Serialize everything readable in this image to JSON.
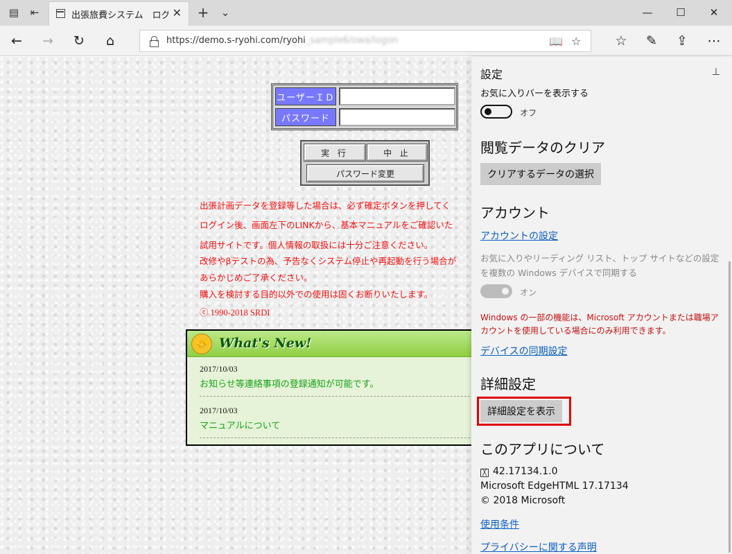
{
  "browser": {
    "tab_title": "出張旅費システム　ログオ",
    "url_visible": "https://demo.s-ryohi.com/ryohi",
    "url_blurred": "_sample6/owa/logon"
  },
  "login": {
    "user_label": "ユーザーＩＤ",
    "password_label": "パスワード",
    "execute_label": "実 行",
    "cancel_label": "中 止",
    "change_password_label": "パスワード変更"
  },
  "notices": [
    "出張計画データを登録等した場合は、必ず確定ボタンを押してく",
    "ログイン後、画面左下のLINKから、基本マニュアルをご確認いた",
    "試用サイトです。個人情報の取扱には十分ご注意ください。",
    "改修やβテストの為、予告なくシステム停止や再起動を行う場合が",
    "あらかじめご了承ください。",
    "購入を検討する目的以外での使用は固くお断りいたします。",
    "ⓒ 1990-2018 SRDI"
  ],
  "whats_new": {
    "title": "What's New!",
    "items": [
      {
        "date": "2017/10/03",
        "text": "お知らせ等連絡事項の登録通知が可能です。"
      },
      {
        "date": "2017/10/03",
        "text": "マニュアルについて"
      }
    ]
  },
  "settings": {
    "title": "設定",
    "favorites_bar_label": "お気に入りバーを表示する",
    "favorites_toggle_state": "オフ",
    "clear_data_heading": "閲覧データのクリア",
    "clear_data_button": "クリアするデータの選択",
    "account_heading": "アカウント",
    "account_settings_link": "アカウントの設定",
    "sync_description": "お気に入りやリーディング リスト、トップ サイトなどの設定を複数の Windows デバイスで同期する",
    "sync_toggle_state": "オン",
    "warning_text": "Windows の一部の機能は、Microsoft アカウントまたは職場アカウントを使用している場合にのみ利用できます。",
    "device_sync_link": "デバイスの同期設定",
    "advanced_heading": "詳細設定",
    "advanced_button": "詳細設定を表示",
    "about_heading": "このアプリについて",
    "app_version": "42.17134.1.0",
    "engine_version": "Microsoft EdgeHTML 17.17134",
    "copyright": "© 2018 Microsoft",
    "terms_link": "使用条件",
    "privacy_link": "プライバシーに関する声明"
  },
  "colors": {
    "login_label_bg": "#7878ff",
    "notice_red": "#f01010",
    "news_green": "#17a217",
    "settings_link": "#0a5ec0",
    "highlight_red": "#e00000"
  }
}
